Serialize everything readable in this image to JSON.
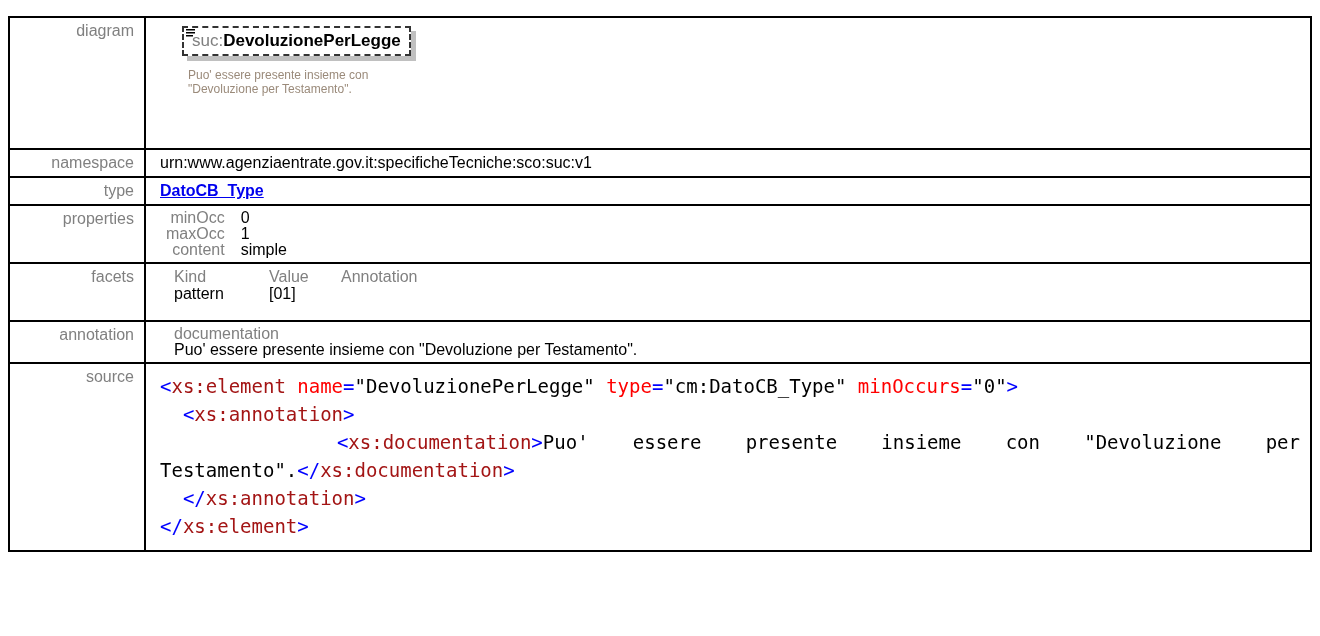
{
  "rows": [
    {
      "kind": "diagram",
      "label": "diagram",
      "element": {
        "prefix": "suc:",
        "name": "DevoluzionePerLegge"
      },
      "note": "Puo' essere presente insieme con \"Devoluzione per Testamento\"."
    },
    {
      "kind": "text",
      "label": "namespace",
      "value": "urn:www.agenziaentrate.gov.it:specificheTecniche:sco:suc:v1"
    },
    {
      "kind": "link",
      "label": "type",
      "value": "DatoCB_Type"
    },
    {
      "kind": "properties",
      "label": "properties",
      "items": [
        {
          "name": "minOcc",
          "value": "0"
        },
        {
          "name": "maxOcc",
          "value": "1"
        },
        {
          "name": "content",
          "value": "simple"
        }
      ]
    },
    {
      "kind": "facets",
      "label": "facets",
      "headings": [
        "Kind",
        "Value",
        "Annotation"
      ],
      "facets": [
        {
          "name": "pattern",
          "value": "[01]"
        }
      ]
    },
    {
      "kind": "annotation",
      "label": "annotation",
      "heading": "documentation",
      "text": "Puo' essere presente insieme con \"Devoluzione per Testamento\"."
    },
    {
      "kind": "source",
      "label": "source",
      "lines": [
        {
          "tokens": [
            {
              "kind": "punct",
              "text": "<"
            },
            {
              "kind": "tag",
              "text": "xs:element"
            },
            {
              "kind": "attr",
              "text": " name"
            },
            {
              "kind": "punct",
              "text": "="
            },
            {
              "kind": "value",
              "text": "\"DevoluzionePerLegge\""
            },
            {
              "kind": "attr",
              "text": " type"
            },
            {
              "kind": "punct",
              "text": "="
            },
            {
              "kind": "value",
              "text": "\"cm:DatoCB_Type\""
            },
            {
              "kind": "attr",
              "text": " minOccurs"
            },
            {
              "kind": "punct",
              "text": "="
            },
            {
              "kind": "value",
              "text": "\"0\""
            },
            {
              "kind": "punct",
              "text": ">"
            }
          ]
        },
        {
          "tokens": [
            {
              "kind": "punct",
              "text": "  <"
            },
            {
              "kind": "tag",
              "text": "xs:annotation"
            },
            {
              "kind": "punct",
              "text": ">"
            }
          ]
        },
        {
          "tokens": [
            {
              "kind": "punct",
              "text": "    <"
            },
            {
              "kind": "tag",
              "text": "xs:documentation"
            },
            {
              "kind": "punct",
              "text": ">"
            },
            {
              "kind": "content",
              "text": "Puo' essere presente insieme con \"Devoluzione per Testamento\"."
            },
            {
              "kind": "punct",
              "text": "</"
            },
            {
              "kind": "tag",
              "text": "xs:documentation"
            },
            {
              "kind": "punct",
              "text": ">"
            }
          ]
        },
        {
          "tokens": [
            {
              "kind": "punct",
              "text": "  </"
            },
            {
              "kind": "tag",
              "text": "xs:annotation"
            },
            {
              "kind": "punct",
              "text": ">"
            }
          ]
        },
        {
          "tokens": [
            {
              "kind": "punct",
              "text": "</"
            },
            {
              "kind": "tag",
              "text": "xs:element"
            },
            {
              "kind": "punct",
              "text": ">"
            }
          ]
        }
      ]
    }
  ]
}
